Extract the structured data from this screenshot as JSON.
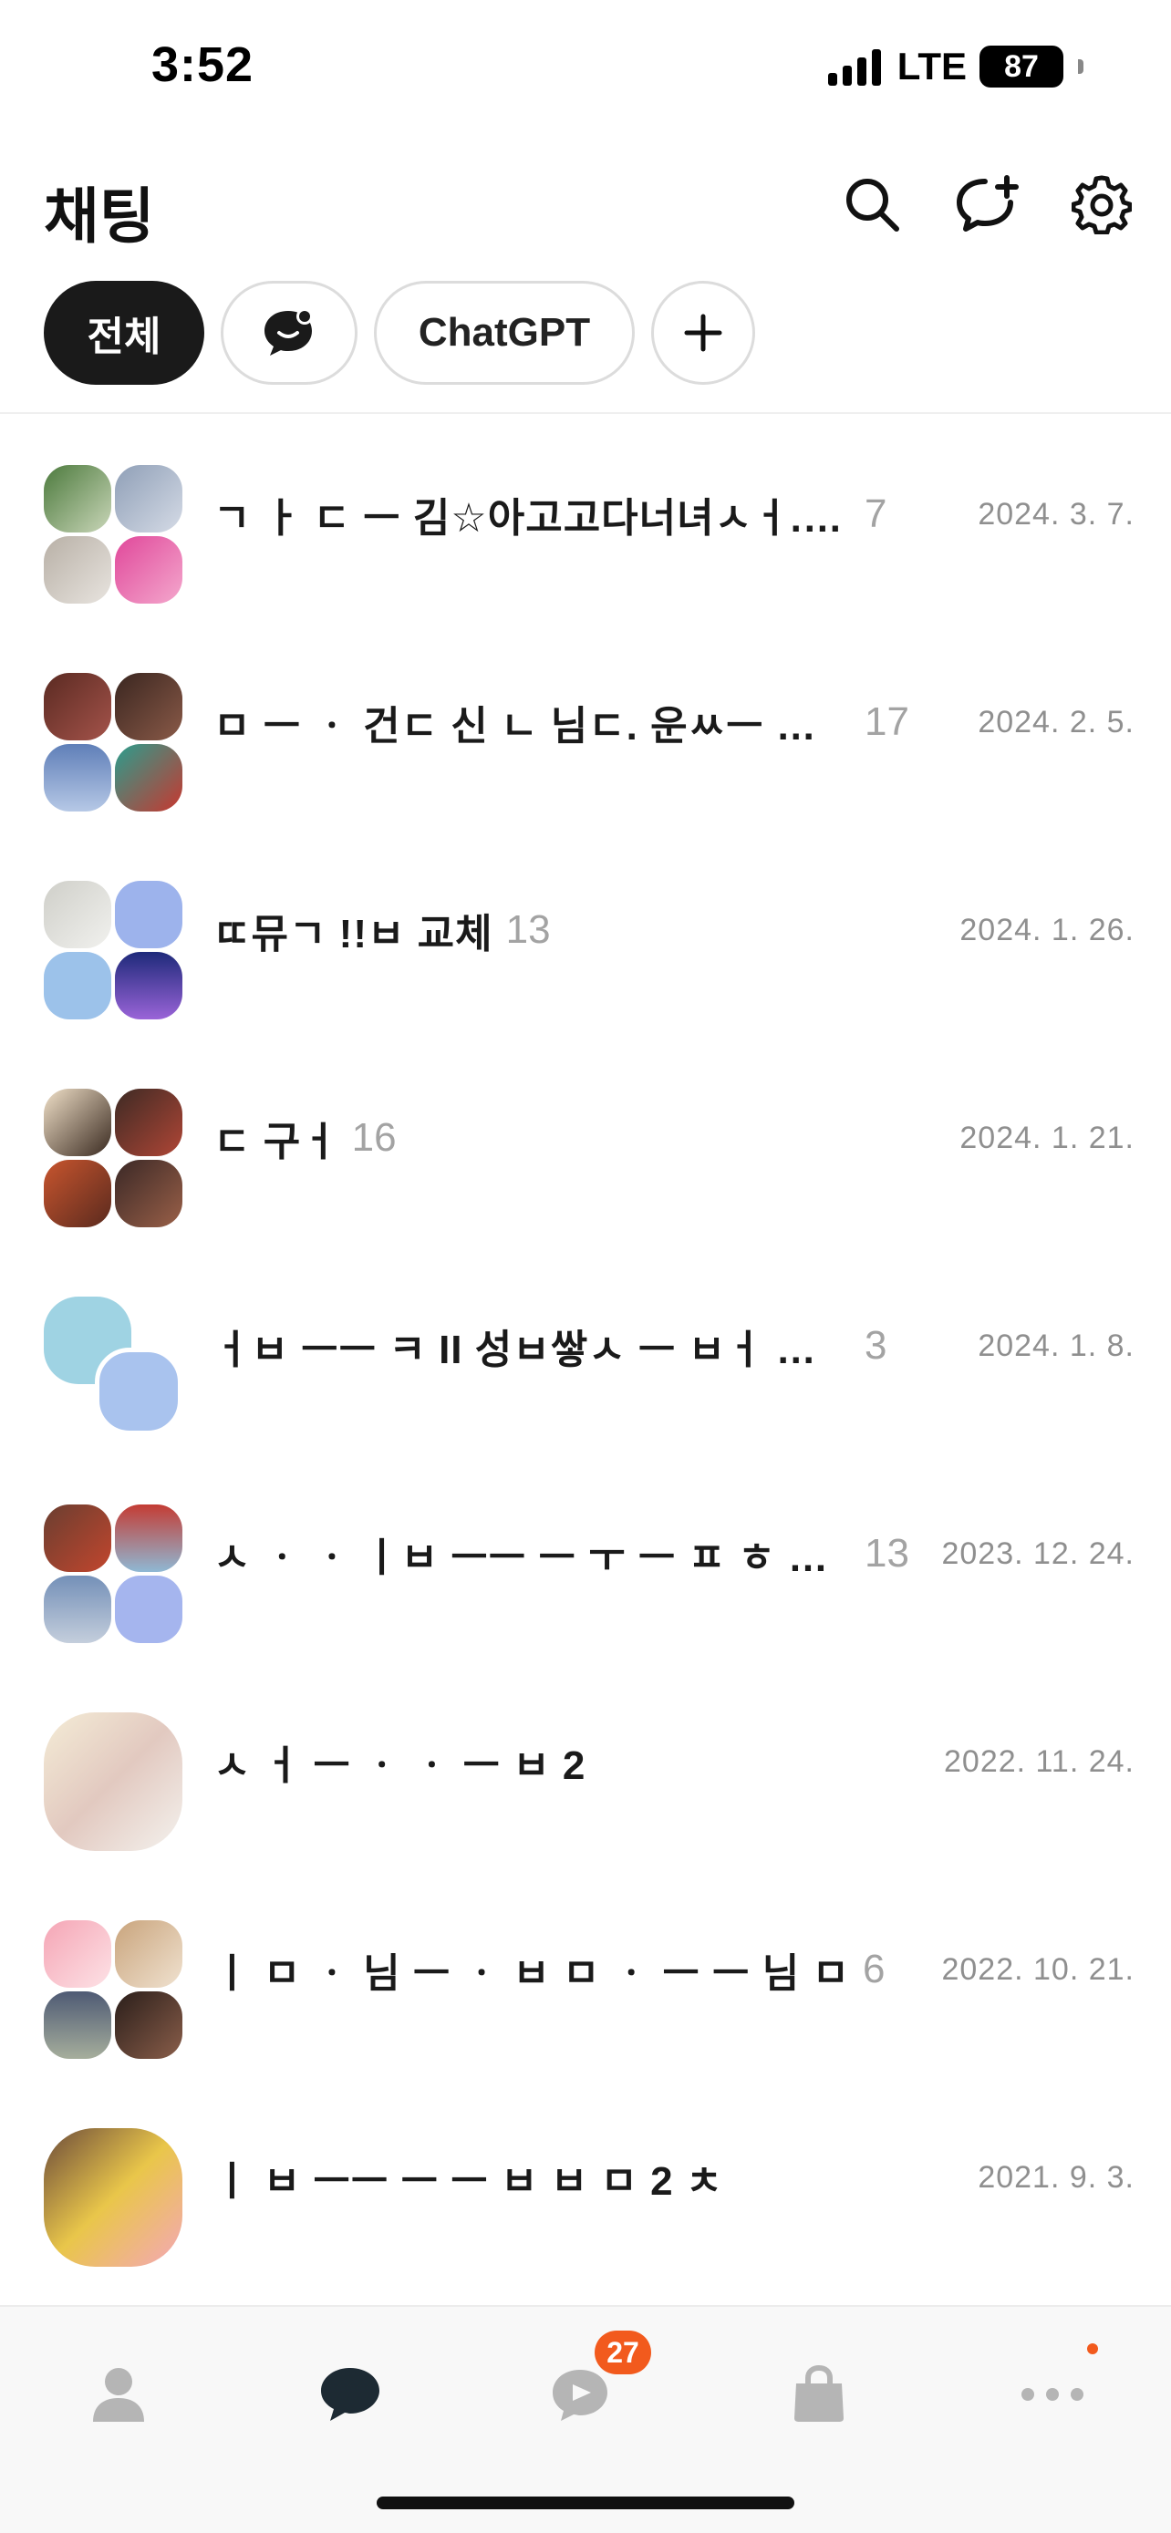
{
  "status_bar": {
    "time": "3:52",
    "network": "LTE",
    "battery": "87"
  },
  "header": {
    "title": "채팅"
  },
  "tabs": [
    {
      "label": "전체",
      "active": true
    },
    {
      "label": "",
      "icon": "emoji-chat-icon"
    },
    {
      "label": "ChatGPT"
    },
    {
      "label": "",
      "icon": "plus-icon"
    }
  ],
  "chats": [
    {
      "name": "ㄱ ㅏ ㄷ ㅡ 김☆아고고다너녀ㅅㅓ. ㅜㄱㅏ ㅗㄷ ㅡ ...",
      "count": "7",
      "date": "2024. 3. 7."
    },
    {
      "name": "ㅁ ㅡ ㆍ 건ㄷ 신 ㄴ 님ㄷ. 운ㅆㅡ ㄱ 학년...",
      "count": "17",
      "date": "2024. 2. 5."
    },
    {
      "name": "ㄸ뮤ㄱ !!ㅂ 교체",
      "count": "13",
      "date": "2024. 1. 26."
    },
    {
      "name": "ㄷ 구ㅓ",
      "count": "16",
      "date": "2024. 1. 21."
    },
    {
      "name": "ㅓㅂ ㅡㅡ ㅋ II 성ㅂ쌓ㅅ ㅡ ㅂㅓ ㅡ ㅋ 나수 ...",
      "count": "3",
      "date": "2024. 1. 8."
    },
    {
      "name": "ㅅ ㆍ ㆍ ㅣㅂ ㅡㅡ ㅡ ㅜ ㅡ ㅍ ㅎ 도신...",
      "count": "13",
      "date": "2023. 12. 24."
    },
    {
      "name": "ㅅ ㅓ ㅡ ㆍ ㆍ ㅡ ㅂ 2",
      "count": "",
      "date": "2022. 11. 24."
    },
    {
      "name": "ㅣ ㅁ ㆍ 님 ㅡ ㆍ ㅂ ㅁ ㆍ ㅡ ㅡ 님 ㅁ",
      "count": "6",
      "date": "2022. 10. 21."
    },
    {
      "name": "ㅣ ㅂ ㅡㅡ ㅡ ㅡ ㅂ ㅂ ㅁ 2 ㅊ",
      "count": "",
      "date": "2021. 9. 3."
    }
  ],
  "bottom_nav": {
    "items": [
      "friends-icon",
      "chat-icon",
      "open-chat-icon",
      "shopping-icon",
      "more-icon"
    ],
    "open_chat_badge": "27"
  },
  "colors": {
    "accent": "#f25a1d",
    "active_tab": "#1a1a1a",
    "date_text": "#8f8f8f"
  }
}
